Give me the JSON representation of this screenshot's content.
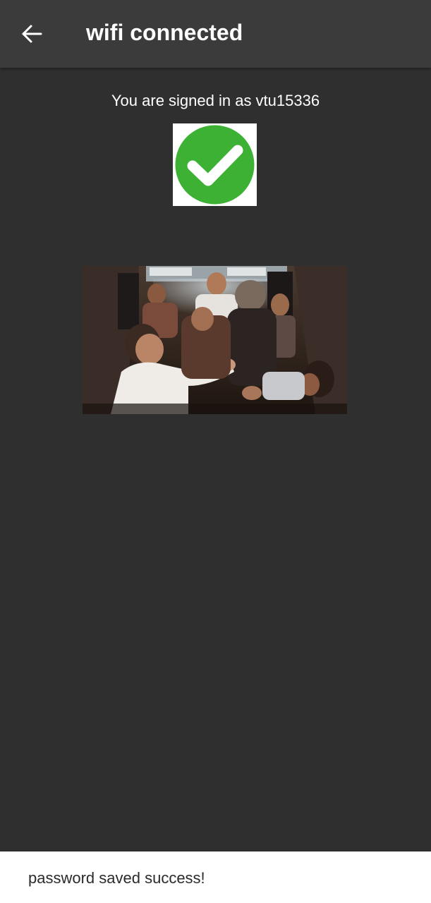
{
  "app_bar": {
    "back_icon": "arrow-left-icon",
    "title": "wifi connected",
    "background_color": "#3b3b3b"
  },
  "main": {
    "signed_in_text": "You are signed in as vtu15336",
    "success_icon": "check-circle-icon",
    "success_color": "#3cb133",
    "photo": "celebration-photo",
    "background_color": "#2f2f2f"
  },
  "toast": {
    "message": "password saved success!"
  }
}
